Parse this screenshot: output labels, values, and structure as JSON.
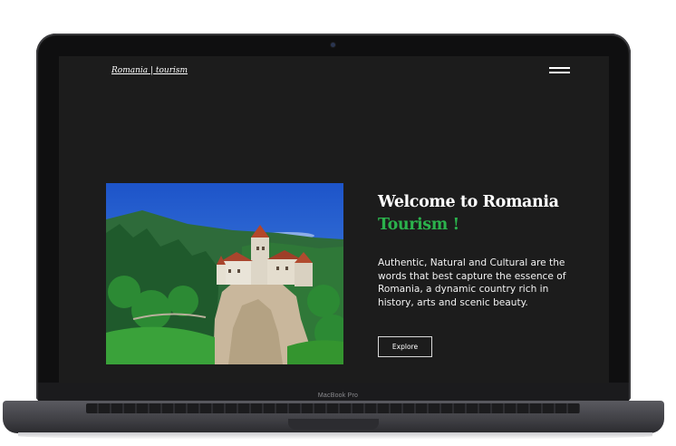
{
  "header": {
    "brand": "Romania | tourism",
    "menu_icon": "hamburger-menu-icon"
  },
  "hero": {
    "title_line1": "Welcome to Romania",
    "title_line2": "Tourism !",
    "description": "Authentic, Natural and Cultural are the words that best capture the essence of Romania, a dynamic country rich in history, arts and scenic beauty.",
    "button_label": "Explore",
    "image_subject": "castle on a rocky cliff surrounded by forest"
  },
  "device": {
    "label": "MacBook Pro"
  },
  "colors": {
    "accent": "#2bb24c",
    "screen_bg": "#1c1c1c",
    "text": "#ffffff"
  }
}
